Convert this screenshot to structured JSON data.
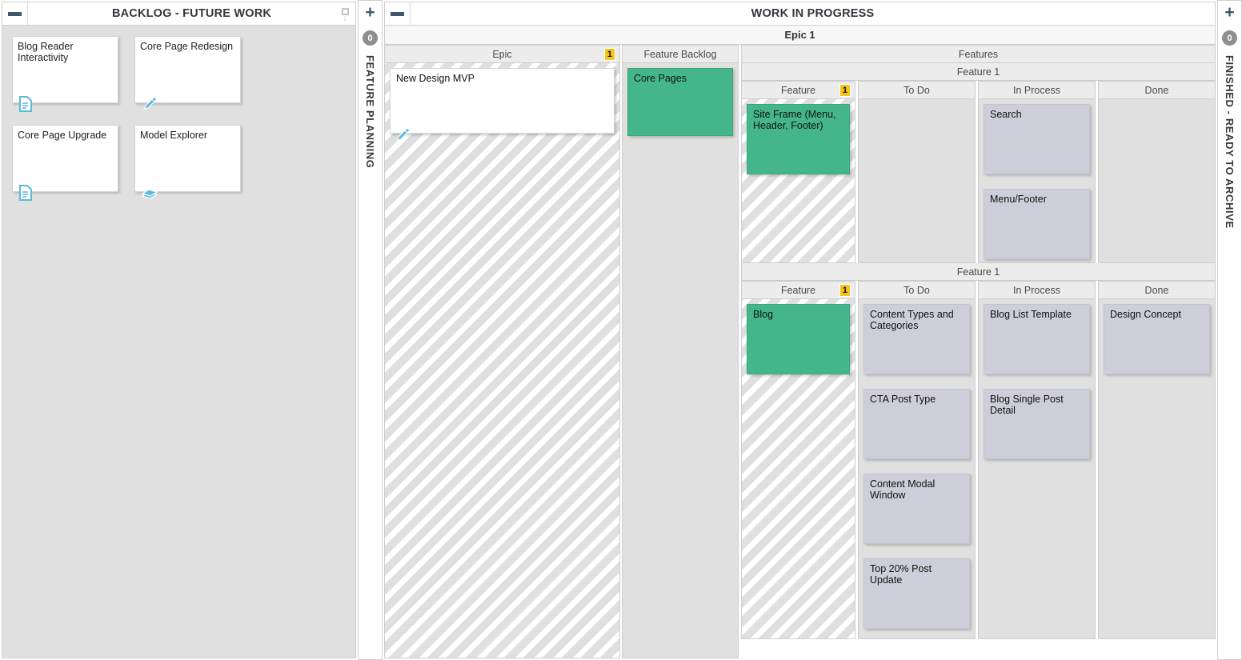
{
  "backlog_panel": {
    "title": "BACKLOG - FUTURE WORK",
    "collapse_icon": "minus-icon",
    "corner_icon": "collapse-down-icon",
    "cards": [
      {
        "text": "Blog Reader Interactivity",
        "icon": "document-icon"
      },
      {
        "text": "Core Page Redesign",
        "icon": "pencil-icon"
      },
      {
        "text": "Core Page Upgrade",
        "icon": "document-icon"
      },
      {
        "text": "Model Explorer",
        "icon": "book-icon"
      }
    ]
  },
  "feature_planning_strip": {
    "add_label": "+",
    "count": "0",
    "label": "FEATURE PLANNING"
  },
  "finished_strip": {
    "add_label": "+",
    "count": "0",
    "label": "FINISHED - READY TO ARCHIVE"
  },
  "wip_panel": {
    "title": "WORK IN PROGRESS",
    "collapse_icon": "minus-icon",
    "epic_title": "Epic 1",
    "epic_column": {
      "header": "Epic",
      "wip_limit": "1",
      "cards": [
        {
          "text": "New Design MVP",
          "icon": "pencil-icon",
          "style": "white"
        }
      ]
    },
    "feature_backlog_column": {
      "header": "Feature Backlog",
      "cards": [
        {
          "text": "Core Pages",
          "style": "green"
        }
      ]
    },
    "features_header": "Features",
    "swimlanes": [
      {
        "title": "Feature 1",
        "columns": [
          {
            "header": "Feature",
            "wip_limit": "1",
            "hatched": true,
            "cards": [
              {
                "text": "Site Frame (Menu, Header, Footer)",
                "style": "green"
              }
            ]
          },
          {
            "header": "To Do",
            "hatched": false,
            "cards": []
          },
          {
            "header": "In Process",
            "hatched": false,
            "cards": [
              {
                "text": "Search",
                "style": "grey"
              },
              {
                "text": "Menu/Footer",
                "style": "grey"
              }
            ]
          },
          {
            "header": "Done",
            "hatched": false,
            "cards": []
          }
        ]
      },
      {
        "title": "Feature 1",
        "columns": [
          {
            "header": "Feature",
            "wip_limit": "1",
            "hatched": true,
            "cards": [
              {
                "text": "Blog",
                "style": "green"
              }
            ]
          },
          {
            "header": "To Do",
            "hatched": false,
            "cards": [
              {
                "text": "Content Types and Categories",
                "style": "grey"
              },
              {
                "text": "CTA Post Type",
                "style": "grey"
              },
              {
                "text": "Content Modal Window",
                "style": "grey"
              },
              {
                "text": "Top 20% Post Update",
                "style": "grey"
              }
            ]
          },
          {
            "header": "In Process",
            "hatched": false,
            "cards": [
              {
                "text": "Blog List Template",
                "style": "grey"
              },
              {
                "text": "Blog Single Post Detail",
                "style": "grey"
              }
            ]
          },
          {
            "header": "Done",
            "hatched": false,
            "cards": [
              {
                "text": "Design Concept",
                "style": "grey"
              }
            ]
          }
        ]
      }
    ]
  },
  "colors": {
    "feature_green": "#45b68c",
    "task_grey": "#cdced9",
    "wip_limit_yellow": "#f5c518",
    "accent_slate": "#41566a",
    "icon_blue": "#5bb8e0"
  }
}
